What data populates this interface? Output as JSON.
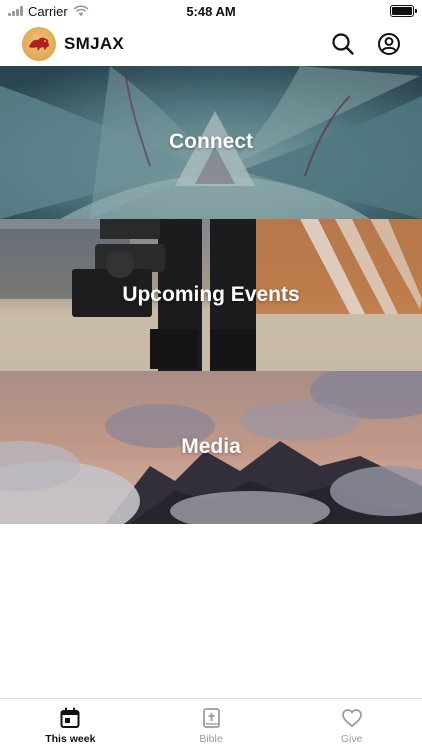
{
  "status_bar": {
    "carrier": "Carrier",
    "time": "5:48 AM"
  },
  "header": {
    "title": "SMJAX",
    "logo_icon": "lion-crest-icon",
    "search_icon": "search-icon",
    "account_icon": "account-icon"
  },
  "cards": [
    {
      "label": "Connect"
    },
    {
      "label": "Upcoming Events"
    },
    {
      "label": "Media"
    }
  ],
  "tabs": [
    {
      "label": "This week",
      "icon": "calendar-icon",
      "active": true
    },
    {
      "label": "Bible",
      "icon": "bible-icon",
      "active": false
    },
    {
      "label": "Give",
      "icon": "heart-icon",
      "active": false
    }
  ],
  "colors": {
    "active_tab": "#111111",
    "inactive_tab": "#9c9c9c",
    "logo_bg": "#e2a857",
    "logo_mark": "#b0201e"
  }
}
